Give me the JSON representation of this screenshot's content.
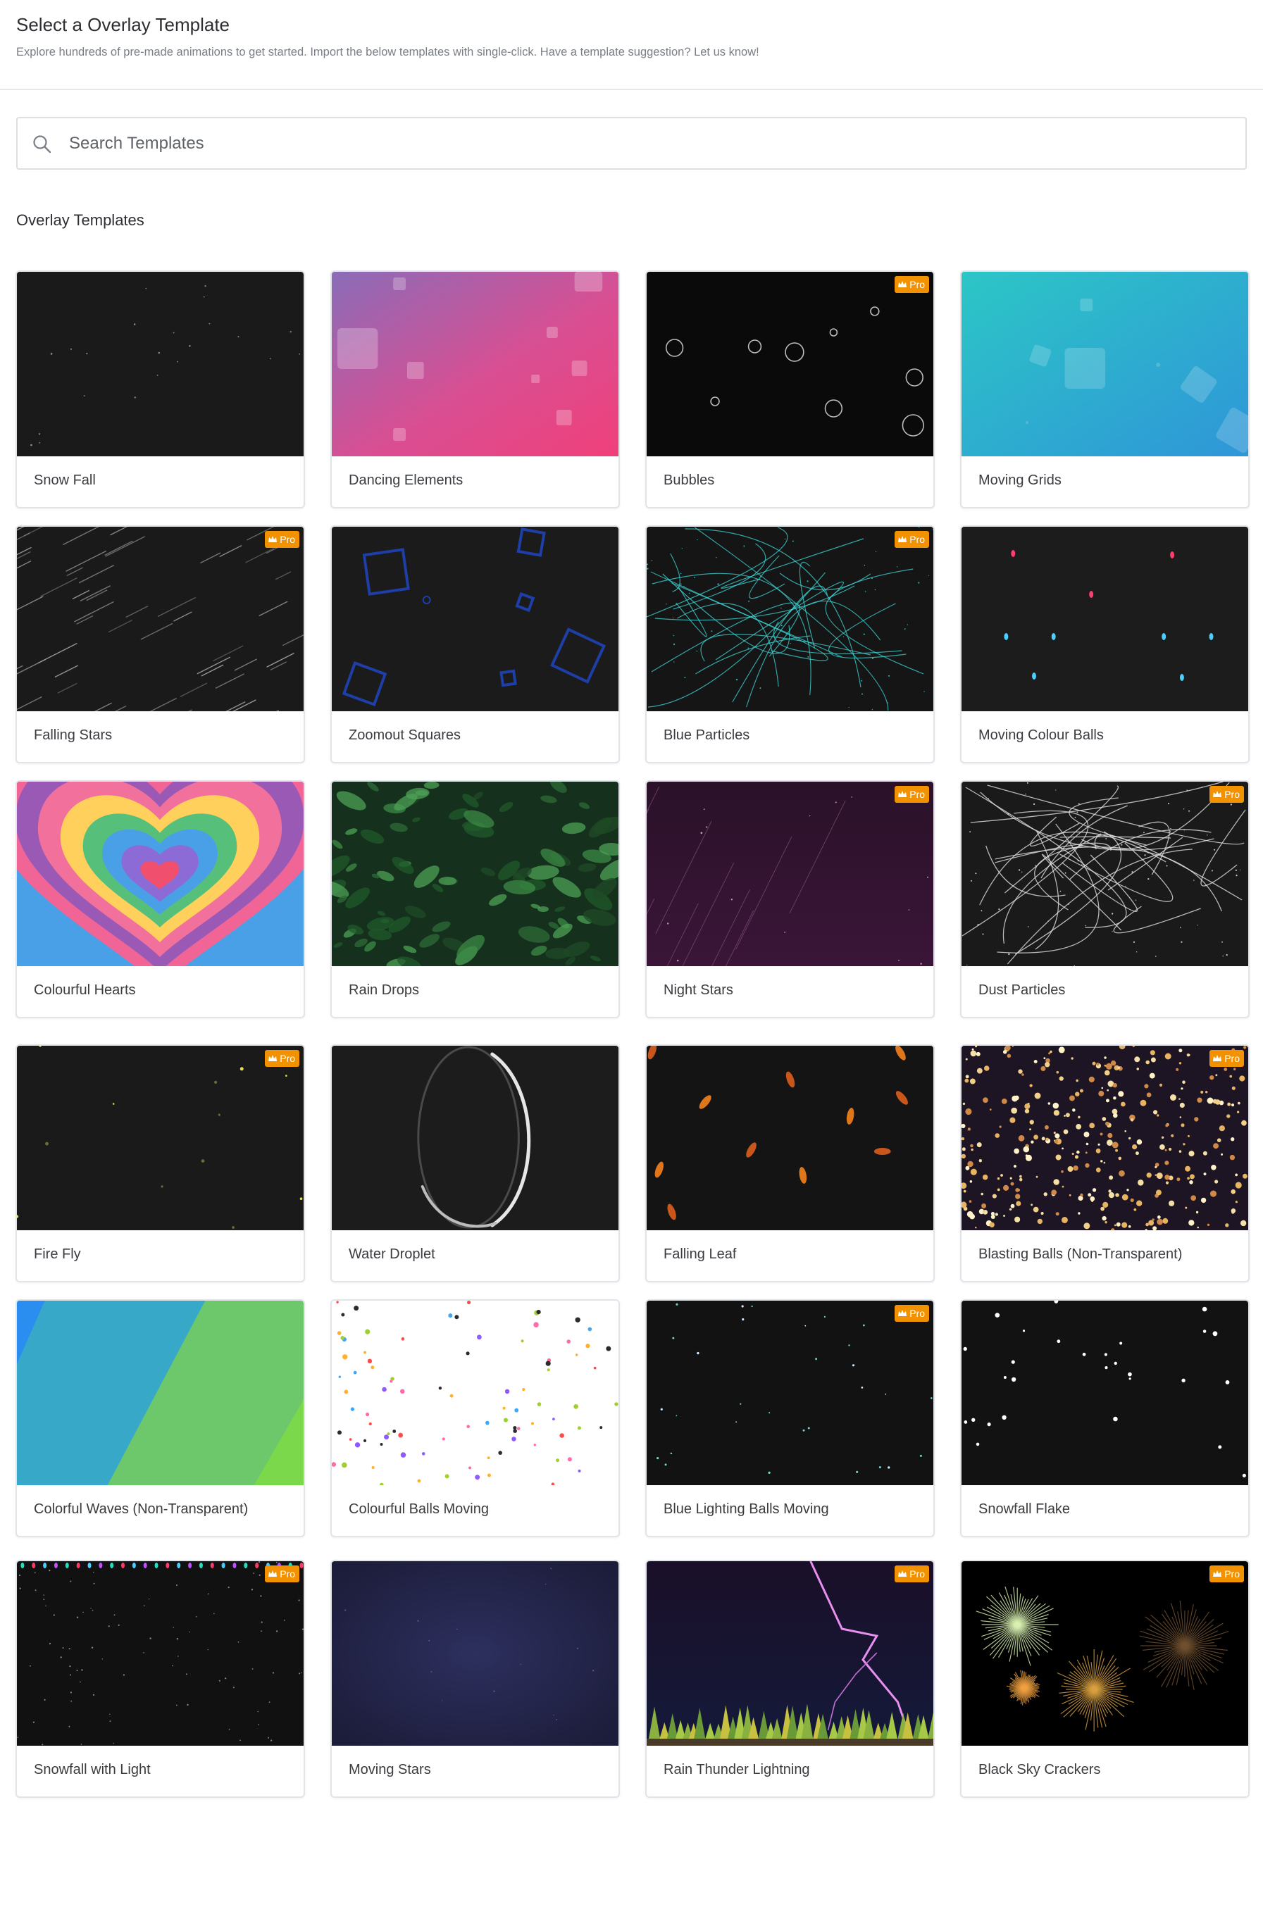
{
  "header": {
    "title": "Select a Overlay Template",
    "subtitle": "Explore hundreds of pre-made animations to get started. Import the below templates with single-click. Have a template suggestion? Let us know!"
  },
  "search": {
    "placeholder": "Search Templates",
    "value": ""
  },
  "section": {
    "title": "Overlay Templates"
  },
  "pro_label": "Pro",
  "colors": {
    "pro_badge": "#f39200",
    "card_border": "#e1e4e8"
  },
  "templates": [
    {
      "label": "Snow Fall",
      "pro": false
    },
    {
      "label": "Dancing Elements",
      "pro": false
    },
    {
      "label": "Bubbles",
      "pro": true
    },
    {
      "label": "Moving Grids",
      "pro": false
    },
    {
      "label": "Falling Stars",
      "pro": true
    },
    {
      "label": "Zoomout Squares",
      "pro": false
    },
    {
      "label": "Blue Particles",
      "pro": true
    },
    {
      "label": "Moving Colour Balls",
      "pro": false
    },
    {
      "label": "Colourful Hearts",
      "pro": false
    },
    {
      "label": "Rain Drops",
      "pro": false
    },
    {
      "label": "Night Stars",
      "pro": true
    },
    {
      "label": "Dust Particles",
      "pro": true
    },
    {
      "label": "Fire Fly",
      "pro": true
    },
    {
      "label": "Water Droplet",
      "pro": false
    },
    {
      "label": "Falling Leaf",
      "pro": false
    },
    {
      "label": "Blasting Balls (Non-Transparent)",
      "pro": true
    },
    {
      "label": "Colorful Waves (Non-Transparent)",
      "pro": false
    },
    {
      "label": "Colourful Balls Moving",
      "pro": false
    },
    {
      "label": "Blue Lighting Balls Moving",
      "pro": true
    },
    {
      "label": "Snowfall Flake",
      "pro": false
    },
    {
      "label": "Snowfall with Light",
      "pro": true
    },
    {
      "label": "Moving Stars",
      "pro": false
    },
    {
      "label": "Rain Thunder Lightning",
      "pro": true
    },
    {
      "label": "Black Sky Crackers",
      "pro": true
    }
  ]
}
